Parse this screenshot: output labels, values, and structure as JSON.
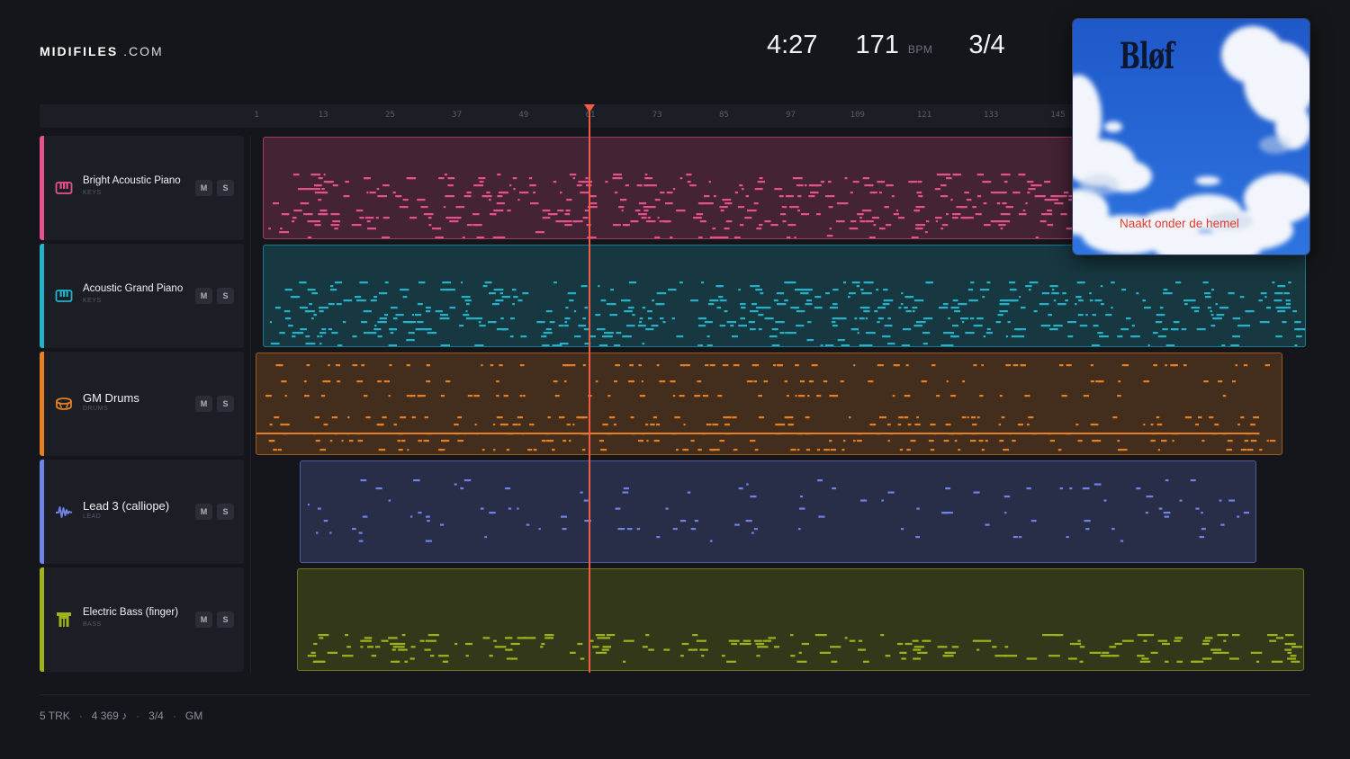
{
  "header": {
    "logo_main": "MIDIFILES",
    "logo_suffix": ".COM",
    "duration": "4:27",
    "tempo": "171",
    "tempo_unit": "BPM",
    "time_signature": "3/4"
  },
  "ruler": {
    "bars": [
      "1",
      "13",
      "25",
      "37",
      "49",
      "61",
      "73",
      "85",
      "97",
      "109",
      "121",
      "133",
      "145"
    ]
  },
  "tracks": [
    {
      "name": "Bright Acoustic Piano",
      "category": "KEYS",
      "icon": "piano-keys-icon",
      "color": "#e8508c",
      "mute": "M",
      "solo": "S"
    },
    {
      "name": "Acoustic Grand Piano",
      "category": "KEYS",
      "icon": "piano-keys-icon",
      "color": "#22b3c9",
      "mute": "M",
      "solo": "S"
    },
    {
      "name": "GM Drums",
      "category": "DRUMS",
      "icon": "drum-icon",
      "color": "#e67e22",
      "mute": "M",
      "solo": "S"
    },
    {
      "name": "Lead 3 (calliope)",
      "category": "LEAD",
      "icon": "waveform-icon",
      "color": "#6f82e8",
      "mute": "M",
      "solo": "S"
    },
    {
      "name": "Electric Bass (finger)",
      "category": "BASS",
      "icon": "bass-icon",
      "color": "#9eb21c",
      "mute": "M",
      "solo": "S"
    }
  ],
  "album": {
    "band": "Bløf",
    "title": "Naakt onder de hemel"
  },
  "footer": {
    "tracks": "5 TRK",
    "notes": "4 369 ♪",
    "signature": "3/4",
    "standard": "GM"
  }
}
